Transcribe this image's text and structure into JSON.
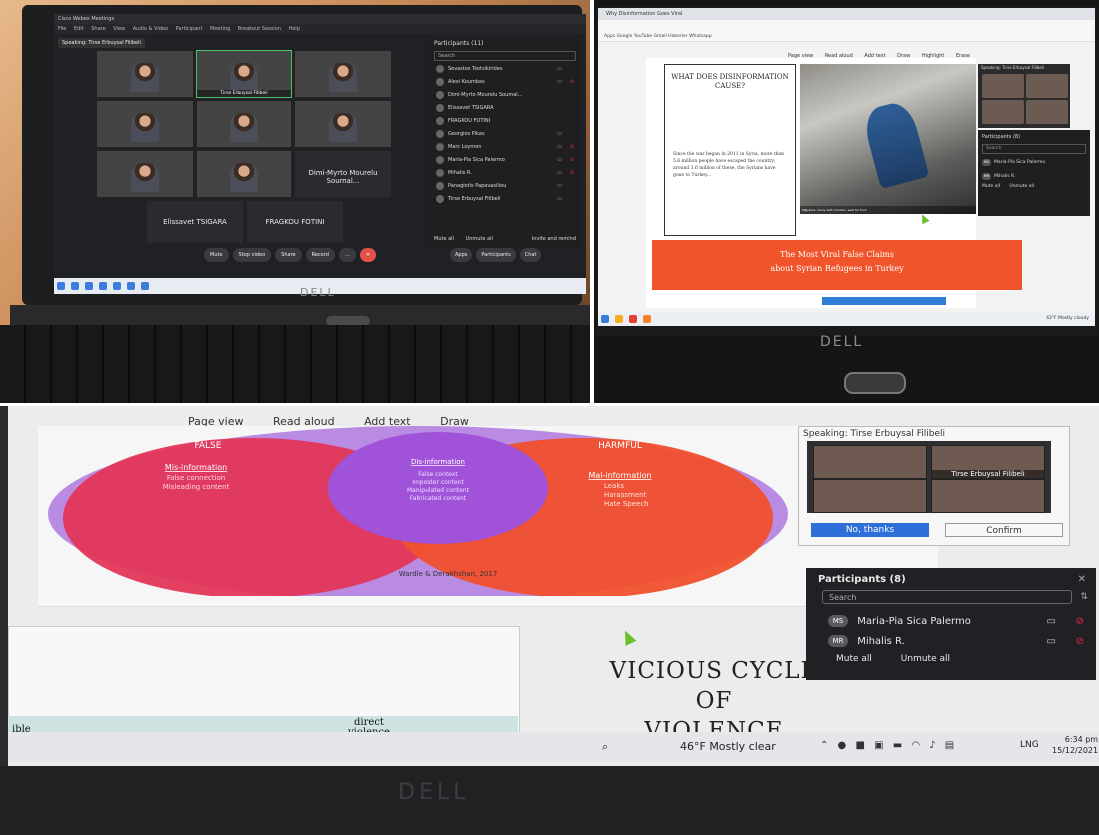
{
  "panel1": {
    "window_title": "Cisco Webex Meetings",
    "menu": [
      "File",
      "Edit",
      "Share",
      "View",
      "Audio & Video",
      "Participant",
      "Meeting",
      "Breakout Session",
      "Help"
    ],
    "speaking": "Speaking: Tirse Erbuysal Filibeli",
    "tiles": [
      {
        "name": ""
      },
      {
        "name": "Tirse Erbuysal Filibeli"
      },
      {
        "name": ""
      },
      {
        "name": ""
      },
      {
        "name": ""
      },
      {
        "name": ""
      },
      {
        "name": ""
      },
      {
        "name": ""
      },
      {
        "name": "Dimi-Myrto Mourelu Soumal..."
      },
      {
        "name": "Elissavet TSIGARA"
      },
      {
        "name": "FRAGKOU FOTINI"
      }
    ],
    "participants_header": "Participants (11)",
    "search_placeholder": "Search",
    "participants": [
      "Sevastos Tsotsikirides",
      "Alexi Koumbas",
      "Dimi-Myrto Mourelu Soumal...",
      "Elissavet TSIGARA",
      "FRAGKOU FOTINI",
      "Georgios Pikas",
      "Marc Loymon",
      "Maria-Pia Sica Palermo",
      "Mihalis R.",
      "Panagiotis Papavasiliou",
      "Tirse Erbuysal Filibeli"
    ],
    "mute_all": "Mute all",
    "unmute_all": "Unmute all",
    "invite": "Invite and remind",
    "controls": [
      "Mute",
      "Stop video",
      "Share",
      "Record",
      "…"
    ],
    "right_controls": [
      "Apps",
      "Participants",
      "Chat"
    ],
    "brand": "DELL"
  },
  "panel2": {
    "tab": "Why Disinformation Goes Viral",
    "bookmarks": "Apps   Google   YouTube   Gmail   Haberler   Whatsapp",
    "pdf_tools": [
      "Page view",
      "Read aloud",
      "Add text",
      "Draw",
      "Highlight",
      "Erase"
    ],
    "card_title": "WHAT DOES DISINFORMATION CAUSE?",
    "card_body": "Since the war began in 2011 in Syria, more than 5.6 million people have escaped the country; around 3.6 million of these, the Syrians have gone to Turkey...",
    "photo_caption": "Migrants, many with children, wait for food",
    "banner_line1": "The Most Viral False Claims",
    "banner_line2": "about Syrian Refugees in Turkey",
    "speaking": "Speaking: Tirse Erbuysal Filibeli",
    "participants_header": "Participants (8)",
    "search_placeholder": "Search",
    "participants": [
      {
        "initials": "MS",
        "name": "Maria-Pia Sica Palermo"
      },
      {
        "initials": "MR",
        "name": "Mihalis R."
      }
    ],
    "mute_all": "Mute all",
    "unmute_all": "Unmute all",
    "tray": "43°F Mostly cloudy",
    "brand": "DELL"
  },
  "panel3": {
    "toolbar": [
      "Page view",
      "Read aloud",
      "Add text",
      "Draw"
    ],
    "venn": {
      "false_label": "FALSE",
      "harmful_label": "HARMFUL",
      "mis_title": "Mis-information",
      "mis_items": [
        "False connection",
        "Misleading content"
      ],
      "dis_title": "Dis-information",
      "dis_items": [
        "False context",
        "Imposter content",
        "Manipulated content",
        "Fabricated content"
      ],
      "mal_title": "Mal-information",
      "mal_items": [
        "Leaks",
        "Harassment",
        "Hate Speech"
      ],
      "citation": "Wardle & Derakhshan, 2017"
    },
    "popup": {
      "speaking": "Speaking: Tirse Erbuysal Filibeli",
      "tile_name": "Tirse Erbuysal Filibeli",
      "no_thanks": "No, thanks",
      "confirm": "Confirm"
    },
    "participants_header": "Participants (8)",
    "search_placeholder": "Search",
    "participants": [
      {
        "initials": "MS",
        "name": "Maria-Pia Sica Palermo"
      },
      {
        "initials": "MR",
        "name": "Mihalis R."
      }
    ],
    "mute_all": "Mute all",
    "unmute_all": "Unmute all",
    "heading_line1": "VICIOUS CYCLE OF",
    "heading_line2": "VIOLENCE",
    "table_left": "ible",
    "table_right_1": "direct",
    "table_right_2": "violence",
    "weather": "46°F  Mostly clear",
    "lang": "LNG",
    "time": "6:34 pm",
    "date": "15/12/2021",
    "brand": "DELL"
  }
}
